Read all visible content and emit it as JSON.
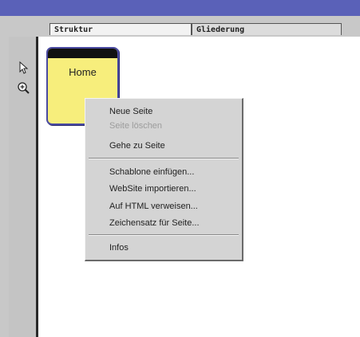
{
  "tabs": [
    {
      "label": "Struktur"
    },
    {
      "label": "Gliederung"
    }
  ],
  "tools": [
    {
      "icon": "arrow-pointer-icon"
    },
    {
      "icon": "zoom-in-icon"
    }
  ],
  "page_node": {
    "label": "Home"
  },
  "context_menu": {
    "items": [
      {
        "label": "Neue Seite",
        "enabled": true
      },
      {
        "label": "Seite löschen",
        "enabled": false
      },
      {
        "label": "Gehe zu Seite",
        "enabled": true
      },
      {
        "label": "Schablone einfügen...",
        "enabled": true
      },
      {
        "label": "WebSite importieren...",
        "enabled": true
      },
      {
        "label": "Auf HTML verweisen...",
        "enabled": true
      },
      {
        "label": "Zeichensatz für Seite...",
        "enabled": true
      },
      {
        "label": "Infos",
        "enabled": true
      }
    ]
  },
  "colors": {
    "titlebar": "#5a61b8",
    "page_node_fill": "#f7ee7c",
    "page_node_border": "#4a4aa0",
    "menu_bg": "#d4d4d4"
  }
}
